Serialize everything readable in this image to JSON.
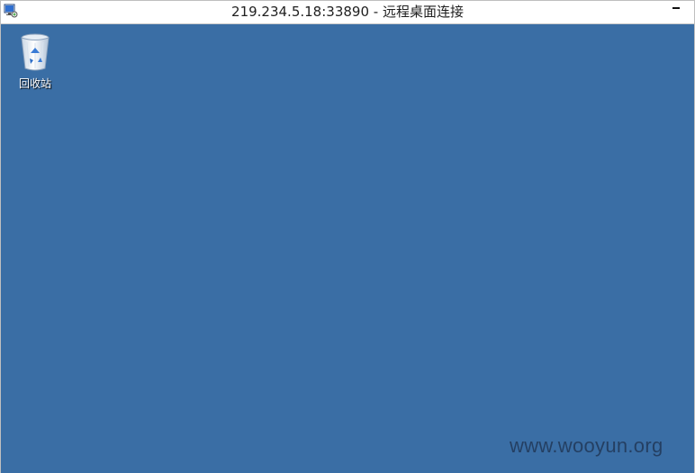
{
  "window": {
    "title": "219.234.5.18:33890 - 远程桌面连接",
    "app_icon": "remote-desktop-icon",
    "minimize_icon": "minimize-icon"
  },
  "desktop": {
    "background_color": "#3a6ea5",
    "icons": [
      {
        "label": "回收站",
        "icon": "recycle-bin-icon"
      }
    ]
  },
  "watermark": {
    "text": "www.wooyun.org"
  }
}
